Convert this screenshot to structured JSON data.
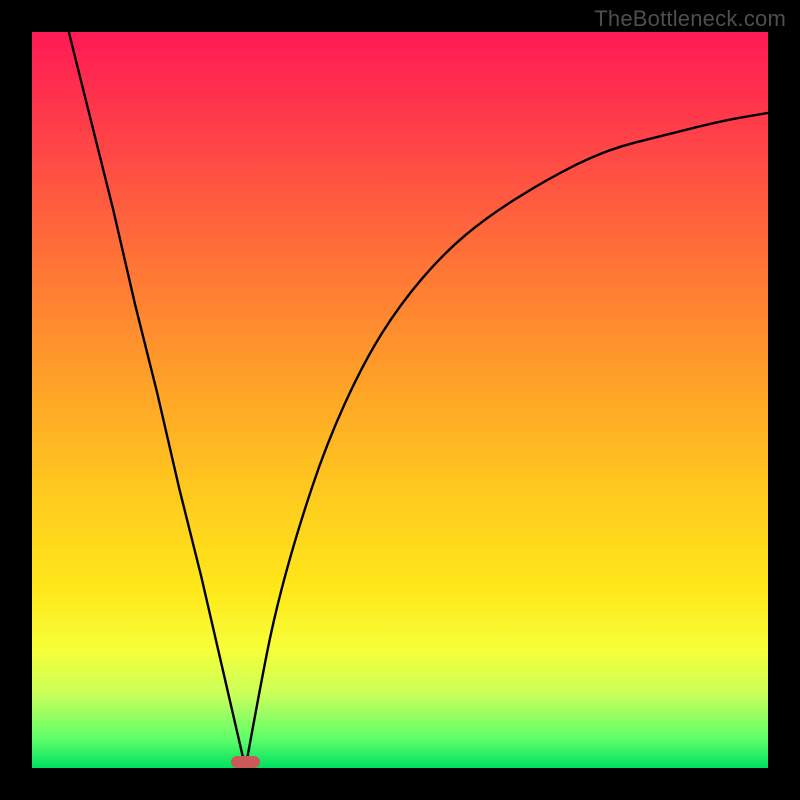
{
  "watermark": "TheBottleneck.com",
  "chart_data": {
    "type": "line",
    "title": "",
    "xlabel": "",
    "ylabel": "",
    "xlim": [
      0,
      100
    ],
    "ylim": [
      0,
      100
    ],
    "grid": false,
    "legend": false,
    "annotations": [],
    "marker": {
      "x": 29,
      "y": 0,
      "width_pct": 4,
      "color": "#ca5a5a"
    },
    "gradient_stops": [
      {
        "pct": 0,
        "color": "#ff1a55"
      },
      {
        "pct": 12,
        "color": "#ff3b4a"
      },
      {
        "pct": 28,
        "color": "#ff6a3a"
      },
      {
        "pct": 45,
        "color": "#ff9a2a"
      },
      {
        "pct": 62,
        "color": "#ffc81f"
      },
      {
        "pct": 76,
        "color": "#ffe91a"
      },
      {
        "pct": 84,
        "color": "#f6ff3a"
      },
      {
        "pct": 90,
        "color": "#c9ff5a"
      },
      {
        "pct": 96,
        "color": "#5fff6a"
      },
      {
        "pct": 100,
        "color": "#00e060"
      }
    ],
    "series": [
      {
        "name": "left-branch",
        "x": [
          5,
          8,
          11,
          14,
          17,
          20,
          23,
          26,
          29
        ],
        "y": [
          100,
          88,
          76,
          63,
          51,
          38,
          26,
          13,
          0
        ]
      },
      {
        "name": "right-branch",
        "x": [
          29,
          31,
          33,
          36,
          40,
          45,
          50,
          56,
          62,
          70,
          78,
          86,
          94,
          100
        ],
        "y": [
          0,
          11,
          21,
          32,
          44,
          55,
          63,
          70,
          75,
          80,
          84,
          86,
          88,
          89
        ]
      }
    ]
  }
}
